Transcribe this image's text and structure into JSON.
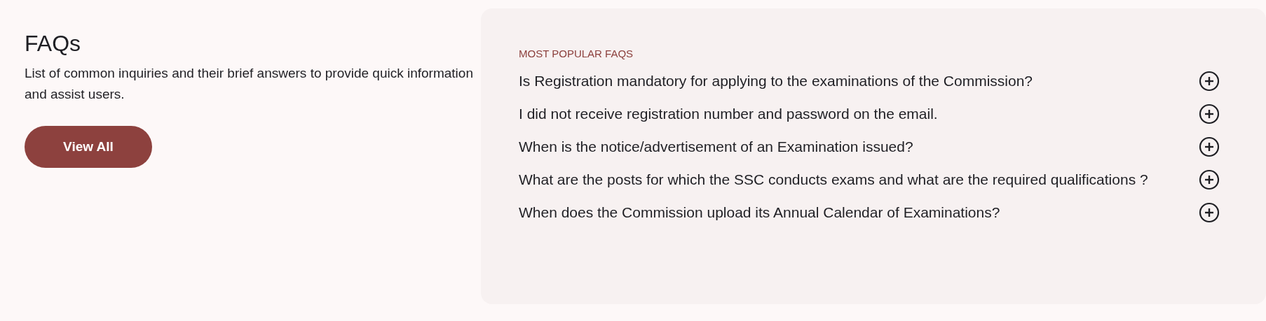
{
  "intro": {
    "title": "FAQs",
    "description": "List of common inquiries and their brief answers to provide quick information and assist users.",
    "button": "View All"
  },
  "faq_panel": {
    "heading": "MOST POPULAR FAQS",
    "questions": [
      {
        "text": "Is Registration mandatory for applying to the examinations of the Commission?",
        "expanded": false
      },
      {
        "text": "I did not receive registration number and password on the email.",
        "expanded": false
      },
      {
        "text": "When is the notice/advertisement of an Examination issued?",
        "expanded": false
      },
      {
        "text": "What are the posts for which the SSC conducts exams and what are the required qualifications ?",
        "expanded": false
      },
      {
        "text": "When does the Commission upload its Annual Calendar of Examinations?",
        "expanded": false
      }
    ]
  }
}
